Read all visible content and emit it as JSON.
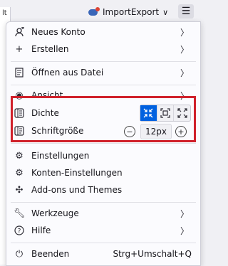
{
  "toolbar": {
    "left_tab_fragment": "lt",
    "account_name": "ImportExport",
    "account_chevron": "∨",
    "menu_icon": "hamburger-icon"
  },
  "menu": {
    "items": [
      {
        "icon": "new-account-icon",
        "label": "Neues Konto",
        "underline": "N",
        "submenu": true
      },
      {
        "icon": "plus-icon",
        "label": "Erstellen",
        "underline": "E",
        "submenu": true
      },
      {
        "icon": "open-file-icon",
        "label": "Öffnen aus Datei",
        "underline": "Ö",
        "submenu": true
      },
      {
        "icon": "eye-icon",
        "label": "Ansicht",
        "underline": "A",
        "submenu": true
      },
      {
        "icon": "density-icon",
        "label": "Dichte"
      },
      {
        "icon": "font-size-icon",
        "label": "Schriftgröße"
      },
      {
        "icon": "settings-icon",
        "label": "Einstellungen"
      },
      {
        "icon": "account-settings-icon",
        "label": "Konten-Einstellungen"
      },
      {
        "icon": "addons-icon",
        "label": "Add-ons und Themes"
      },
      {
        "icon": "tools-icon",
        "label": "Werkzeuge",
        "underline": "W",
        "submenu": true
      },
      {
        "icon": "help-icon",
        "label": "Hilfe",
        "underline": "H",
        "submenu": true
      },
      {
        "icon": "quit-icon",
        "label": "Beenden",
        "underline": "B",
        "shortcut": "Strg+Umschalt+Q"
      }
    ],
    "density_options": [
      "compact",
      "normal",
      "relaxed"
    ],
    "density_selected": "compact",
    "font_size_value": "12px",
    "accent_color": "#0061e0",
    "highlight_color": "#d0212b"
  }
}
